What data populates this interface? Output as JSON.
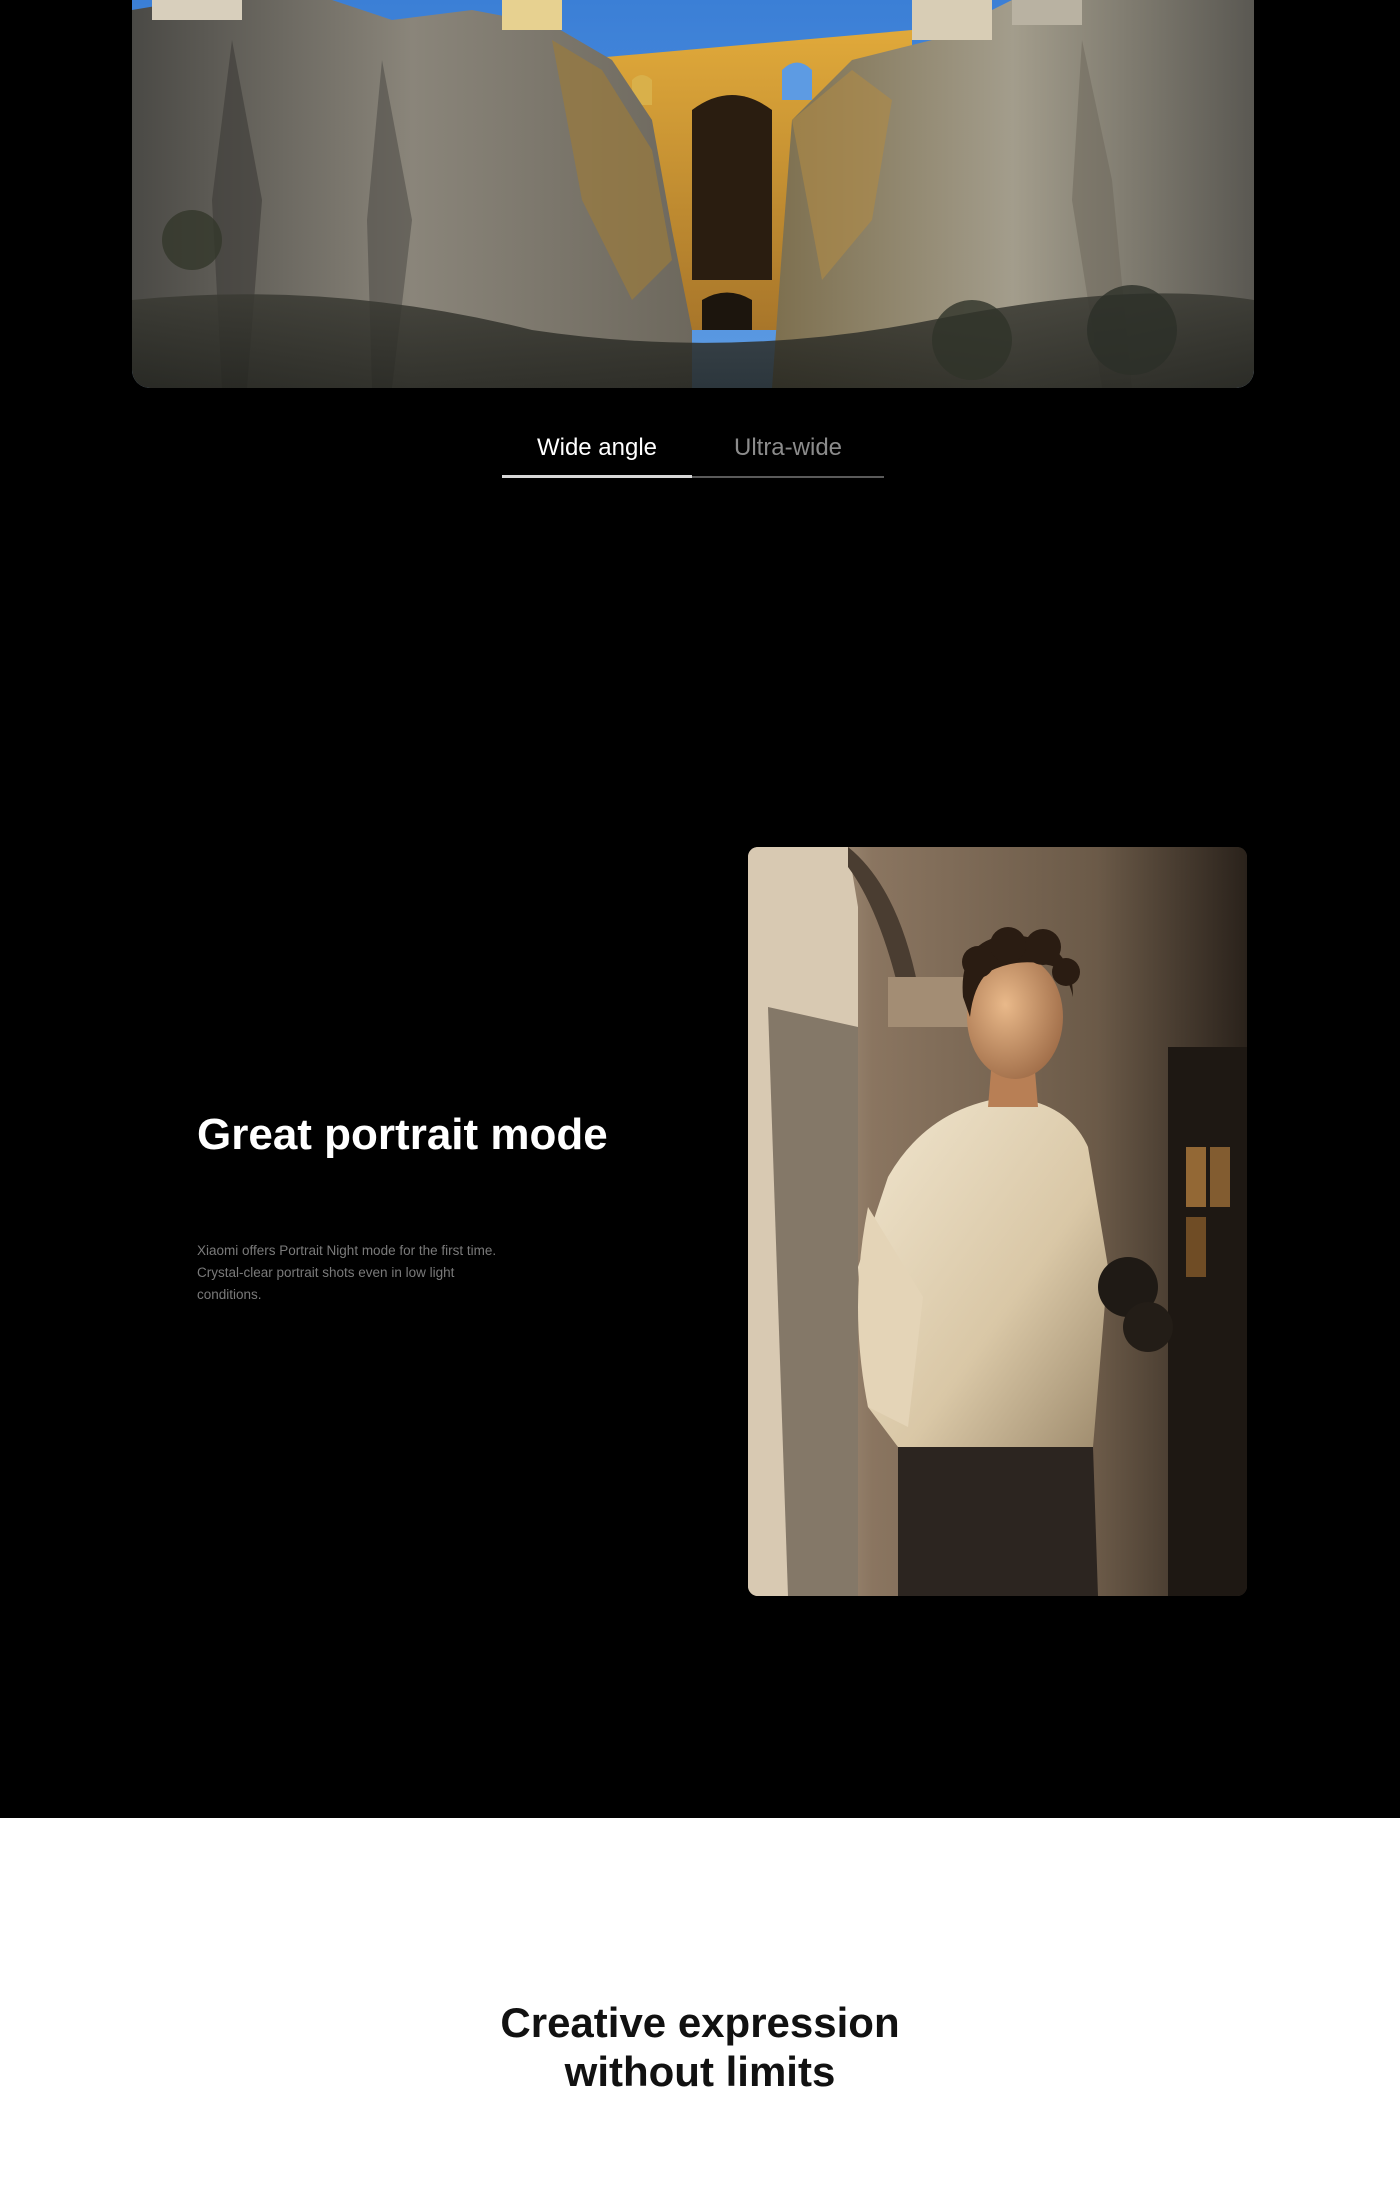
{
  "camera_tabs": {
    "items": [
      {
        "label": "Wide angle",
        "active": true
      },
      {
        "label": "Ultra-wide",
        "active": false
      }
    ]
  },
  "portrait_section": {
    "title": "Great portrait mode",
    "description_line_1": "Xiaomi offers Portrait Night mode for the first time.",
    "description_line_2": "Crystal-clear portrait shots even in low light conditions."
  },
  "creative_section": {
    "title_line_1": "Creative expression",
    "title_line_2": "without limits"
  },
  "colors": {
    "page_background": "#000000",
    "bottom_section_background": "#ffffff",
    "active_tab_text": "#ffffff",
    "inactive_tab_text": "#8c8c8c",
    "description_text": "#7a7a7a"
  }
}
